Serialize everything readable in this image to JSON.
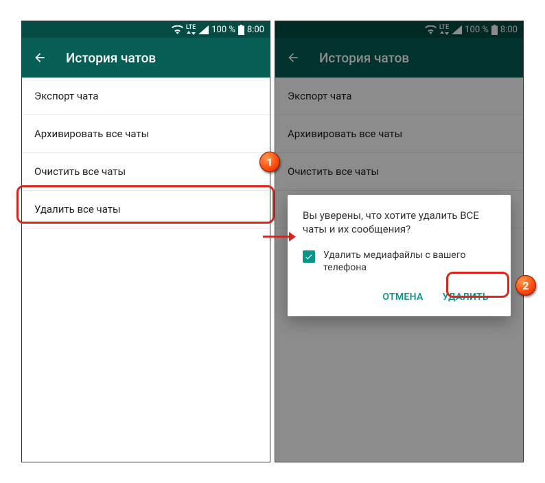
{
  "statusbar": {
    "lte": "LTE",
    "percent": "100 %",
    "time": "8:00"
  },
  "appbar": {
    "title": "История чатов"
  },
  "menu": {
    "items": [
      {
        "label": "Экспорт чата"
      },
      {
        "label": "Архивировать все чаты"
      },
      {
        "label": "Очистить все чаты"
      },
      {
        "label": "Удалить все чаты"
      }
    ]
  },
  "dialog": {
    "text": "Вы уверены, что хотите удалить ВСЕ чаты и их сообщения?",
    "checkbox_label": "Удалить медиафайлы с вашего телефона",
    "cancel": "ОТМЕНА",
    "confirm": "УДАЛИТЬ"
  },
  "annotations": {
    "badge1": "1",
    "badge2": "2"
  }
}
